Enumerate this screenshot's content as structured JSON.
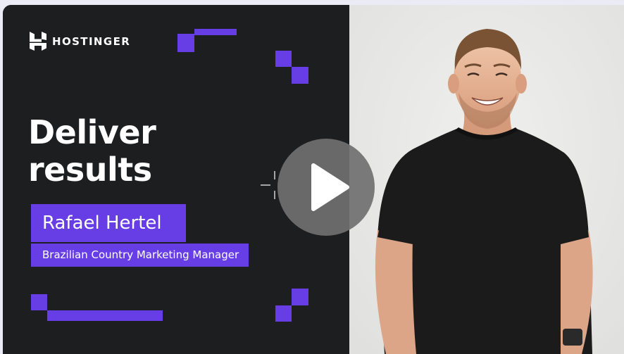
{
  "brand": {
    "name": "HOSTINGER"
  },
  "headline": {
    "line1": "Deliver",
    "line2": "results"
  },
  "speaker": {
    "name": "Rafael Hertel",
    "role": "Brazilian Country Marketing Manager"
  },
  "video": {
    "play_icon": "play-icon"
  },
  "colors": {
    "accent": "#673de6",
    "panel_dark": "#1d1e20",
    "photo_bg": "#e9e9e7",
    "play_overlay": "#707070"
  }
}
